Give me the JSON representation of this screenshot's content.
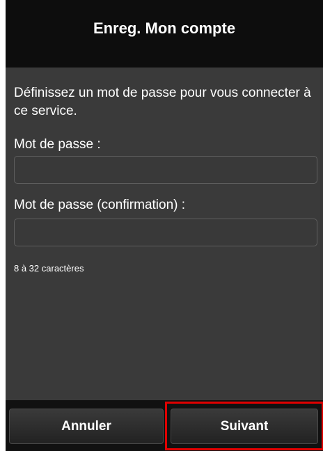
{
  "header": {
    "title": "Enreg. Mon compte"
  },
  "form": {
    "intro": "Définissez un mot de passe pour vous connecter à ce service.",
    "password_label": "Mot de passe :",
    "password_value": "",
    "confirm_label": "Mot de passe (confirmation) :",
    "confirm_value": "",
    "hint": "8 à 32 caractères"
  },
  "footer": {
    "cancel_label": "Annuler",
    "next_label": "Suivant",
    "highlight_color": "#e00000"
  }
}
